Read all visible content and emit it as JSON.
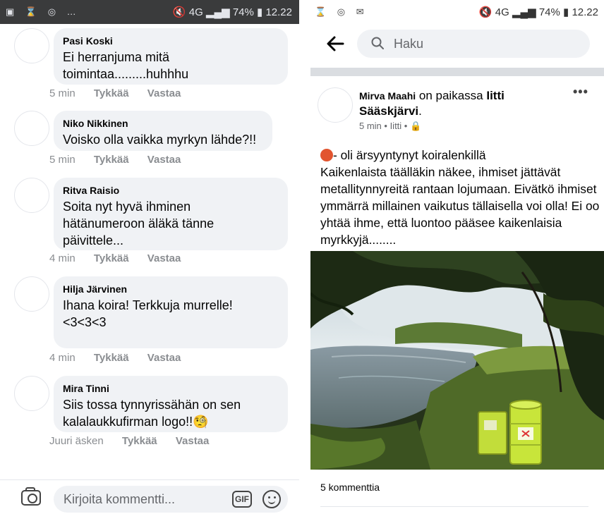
{
  "left_panel": {
    "status_bar": {
      "time": "12.22",
      "battery": "74%",
      "network": "4G"
    },
    "comments": [
      {
        "name": "Pasi Koski",
        "text_lines": [
          "Ei herranjuma mitä",
          "toimintaa.........huhhhu"
        ],
        "time": "5 min",
        "like": "Tykkää",
        "reply": "Vastaa"
      },
      {
        "name": "Niko Nikkinen",
        "text_lines": [
          "Voisko olla vaikka myrkyn lähde?!!"
        ],
        "time": "5 min",
        "like": "Tykkää",
        "reply": "Vastaa"
      },
      {
        "name": "Ritva Raisio",
        "text_lines": [
          "Soita nyt hyvä ihminen",
          "hätänumeroon äläkä tänne",
          "päivittele..."
        ],
        "time": "4 min",
        "like": "Tykkää",
        "reply": "Vastaa"
      },
      {
        "name": "Hilja Järvinen",
        "text_lines": [
          "Ihana koira! Terkkuja murrelle!",
          "<3<3<3"
        ],
        "time": "4 min",
        "like": "Tykkää",
        "reply": "Vastaa"
      },
      {
        "name": "Mira Tinni",
        "text_lines": [
          "Siis tossa tynnyrissähän on sen",
          "kalalaukkufirman logo!!🧐"
        ],
        "time": "Juuri äsken",
        "like": "Tykkää",
        "reply": "Vastaa"
      }
    ],
    "composer": {
      "placeholder": "Kirjoita kommentti...",
      "gif_label": "GIF"
    }
  },
  "right_panel": {
    "status_bar": {
      "time": "12.22",
      "battery": "74%",
      "network": "4G"
    },
    "search": {
      "placeholder": "Haku"
    },
    "post": {
      "author": "Mirva Maahi",
      "location_prefix": "on paikassa",
      "location_bold": "Iitti",
      "location_line2": "Sääskjärvi",
      "meta": "5 min • Iitti •",
      "feeling": "- oli ärsyyntynyt koiralenkillä",
      "body": "Kaikenlaista täälläkin näkee, ihmiset jättävät metallitynnyreitä rantaan lojumaan. Eivätkö ihmiset ymmärrä millainen vaikutus tällaisella voi olla! Ei oo yhtää ihme, että luontoo pääsee kaikenlaisia myrkkyjä........",
      "comment_count": "5 kommenttia"
    }
  }
}
